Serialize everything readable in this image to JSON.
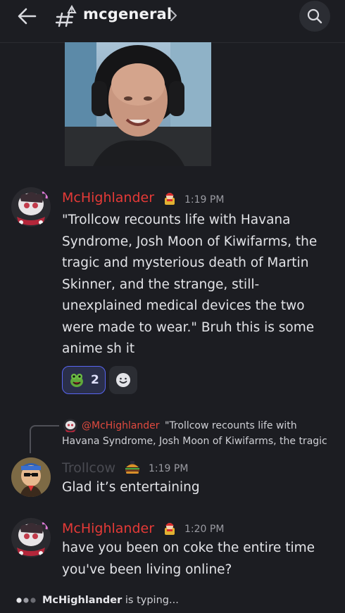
{
  "header": {
    "channel_name": "mcgeneral",
    "back_icon": "arrow-left-icon",
    "channel_icon": "text-channel-rules-icon",
    "search_icon": "search-icon"
  },
  "messages": [
    {
      "author": "McHighlander",
      "time": "1:19 PM",
      "text": "\"Trollcow recounts life with Havana Syndrome, Josh Moon of Kiwifarms, the tragic and mysterious death of Martin Skinner, and the strange, still-unexplained medical devices the two were made to wear.\" Bruh this is some anime sh it",
      "reactions": [
        {
          "emoji": "frog-emoji",
          "count": "2"
        }
      ]
    },
    {
      "reply": {
        "mention": "@McHighlander",
        "text_line1": "\"Trollcow recounts life with",
        "text_line2": "Havana Syndrome, Josh Moon of Kiwifarms, the tragic"
      },
      "author": "Trollcow",
      "time": "1:19 PM",
      "text": "Glad it’s entertaining"
    },
    {
      "author": "McHighlander",
      "time": "1:20 PM",
      "text": "have you been on coke the entire time you've been living online?"
    }
  ],
  "typing": {
    "user": "McHighlander",
    "suffix": " is typing..."
  },
  "colors": {
    "background": "#1c1d22",
    "author_red": "#e53a37",
    "reaction_accent": "#5865f2"
  }
}
